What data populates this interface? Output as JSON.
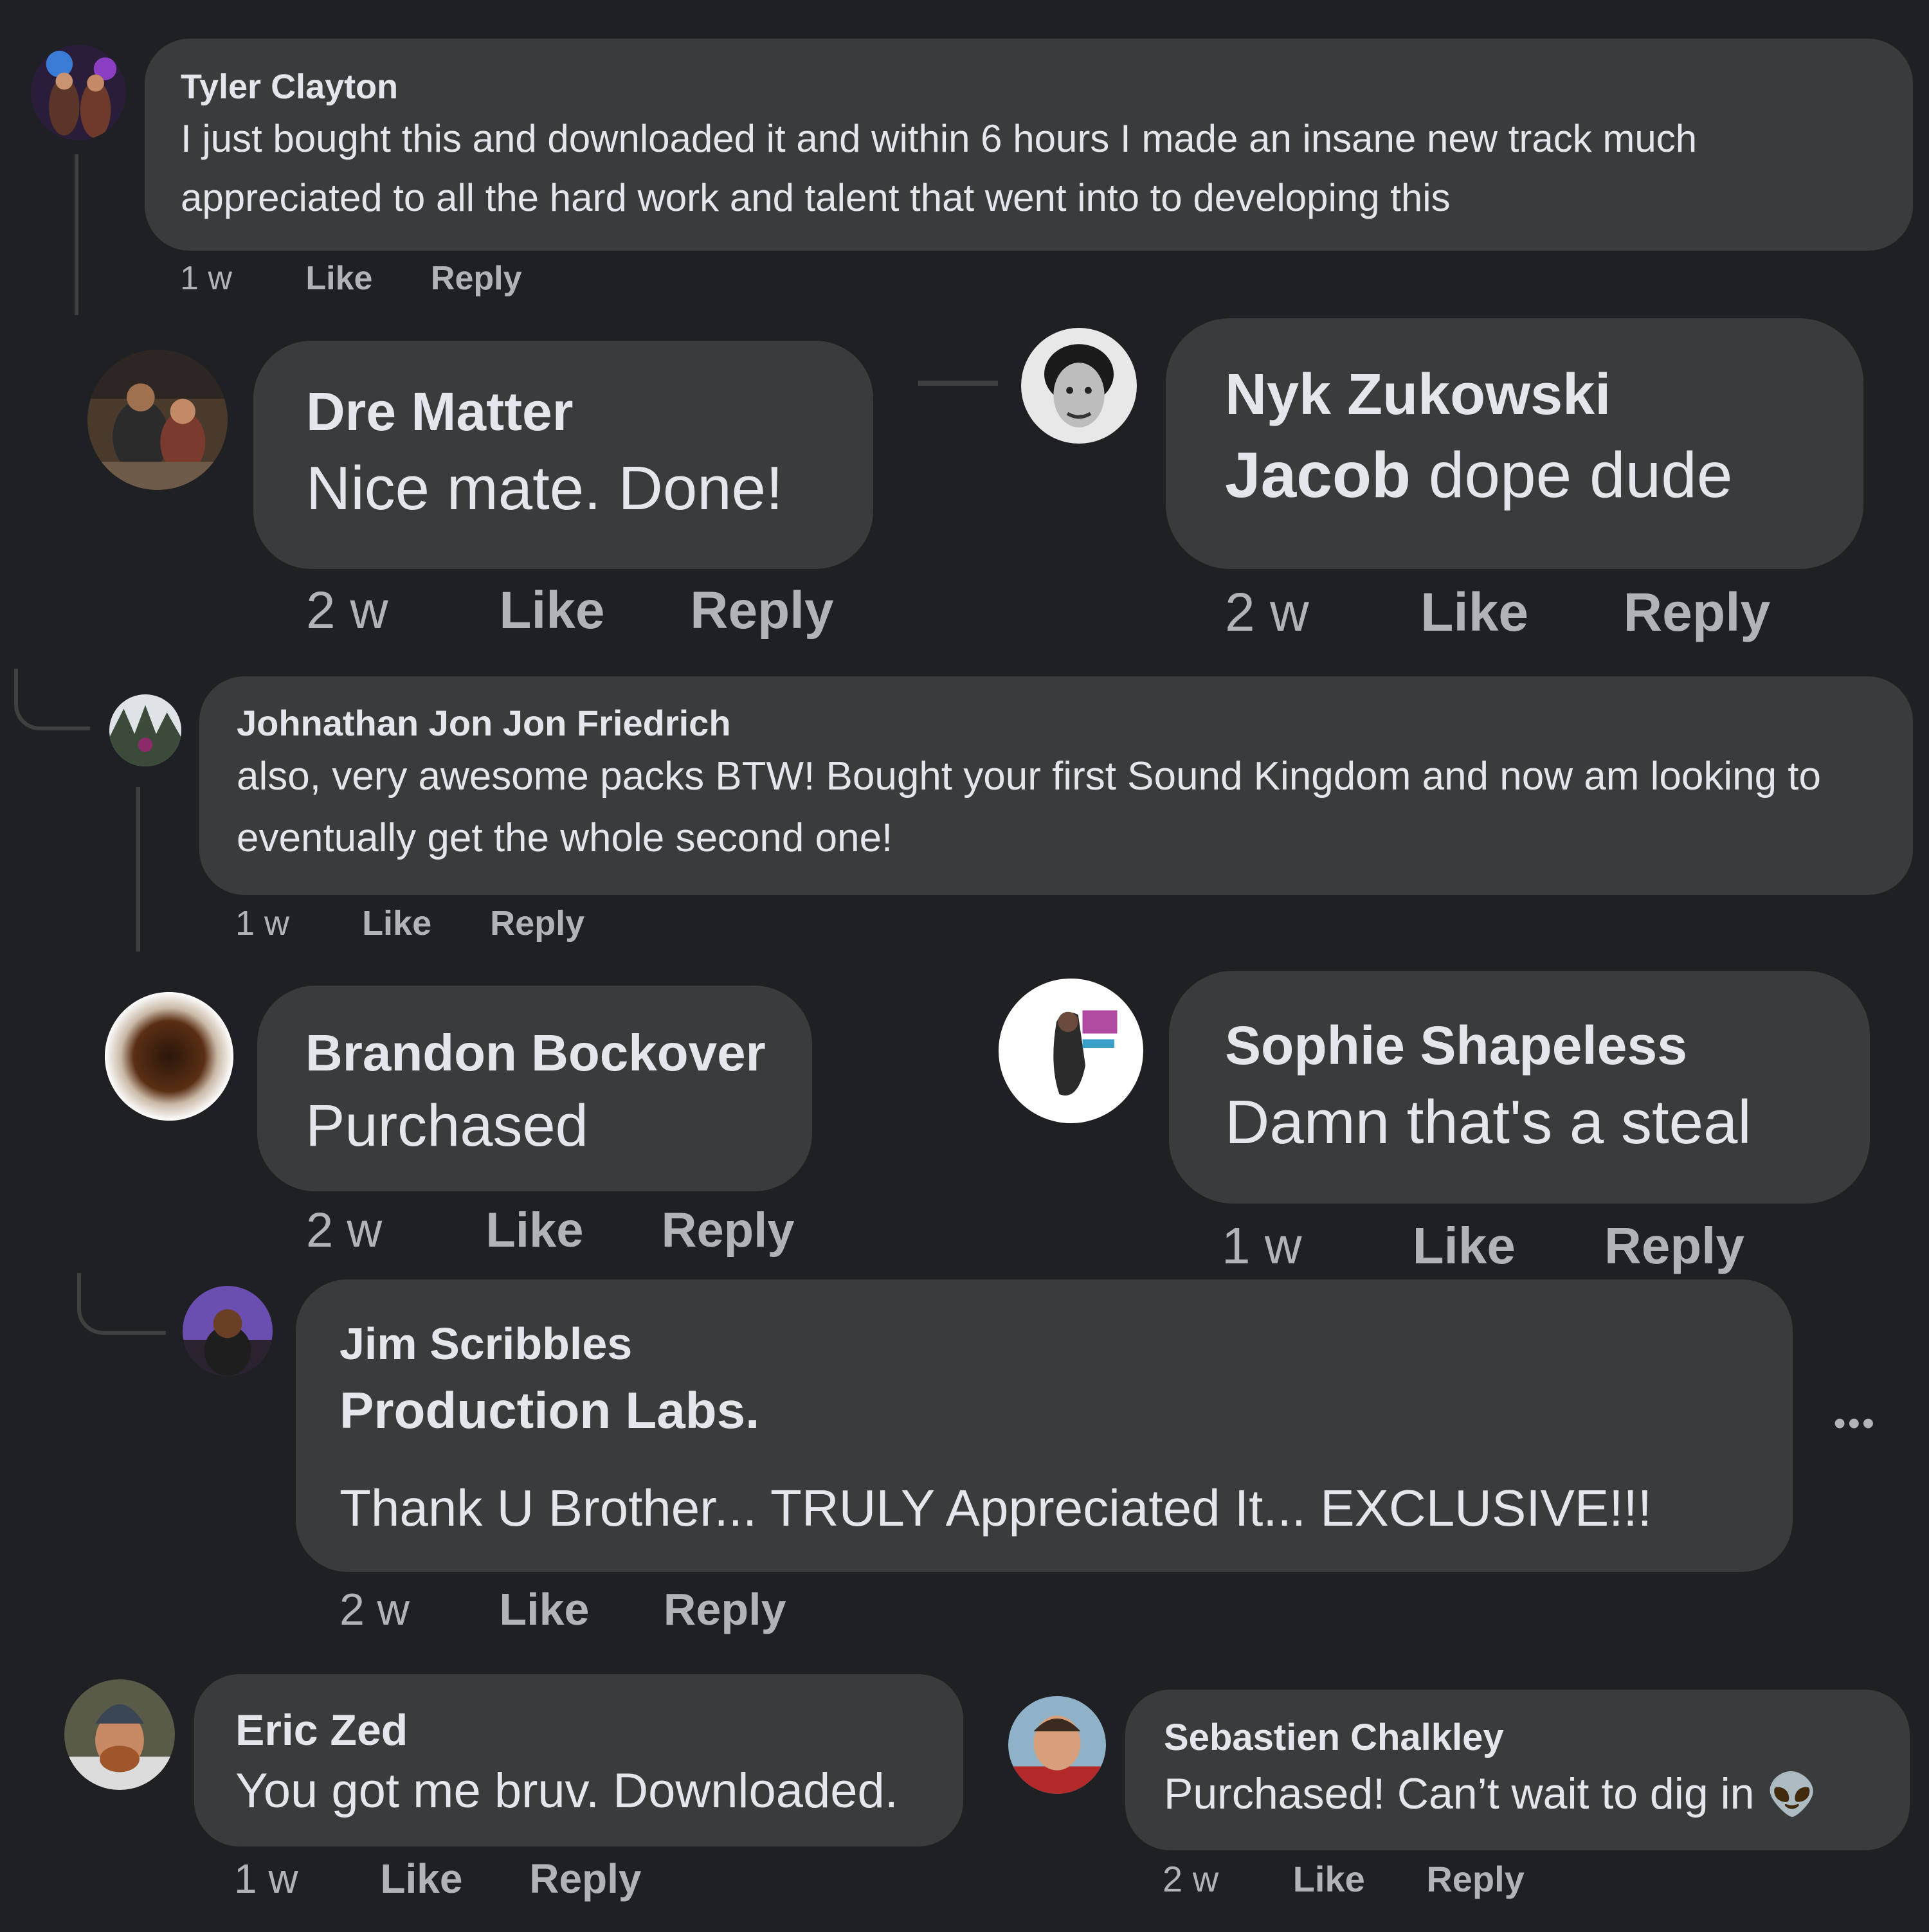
{
  "comments": [
    {
      "author": "Tyler Clayton",
      "text": "I just bought this and downloaded it and within 6 hours I made an insane new track much appreciated to all the hard work and talent that went into to developing this",
      "time": "1 w",
      "like": "Like",
      "reply": "Reply"
    },
    {
      "author": "Dre Matter",
      "text": "Nice mate. Done!",
      "time": "2 w",
      "like": "Like",
      "reply": "Reply"
    },
    {
      "author": "Nyk Zukowski",
      "tag": "Jacob",
      "text": " dope dude",
      "time": "2 w",
      "like": "Like",
      "reply": "Reply"
    },
    {
      "author": "Johnathan Jon Jon Friedrich",
      "text": "also, very awesome packs BTW! Bought your first Sound Kingdom and now am looking to eventually get the whole second one!",
      "time": "1 w",
      "like": "Like",
      "reply": "Reply"
    },
    {
      "author": "Brandon Bockover",
      "text": "Purchased",
      "time": "2 w",
      "like": "Like",
      "reply": "Reply"
    },
    {
      "author": "Sophie Shapeless",
      "text": "Damn that's a steal",
      "time": "1 w",
      "like": "Like",
      "reply": "Reply"
    },
    {
      "author": "Jim Scribbles",
      "tag": "Production Labs.",
      "text": "Thank U Brother... TRULY Appreciated It... EXCLUSIVE!!!",
      "time": "2 w",
      "like": "Like",
      "reply": "Reply",
      "more": "•••"
    },
    {
      "author": "Eric Zed",
      "text": "You got me bruv. Downloaded.",
      "time": "1 w",
      "like": "Like",
      "reply": "Reply"
    },
    {
      "author": "Sebastien Chalkley",
      "text": "Purchased! Can’t wait to dig in",
      "emoji": "👽",
      "time": "2 w",
      "like": "Like",
      "reply": "Reply"
    }
  ]
}
